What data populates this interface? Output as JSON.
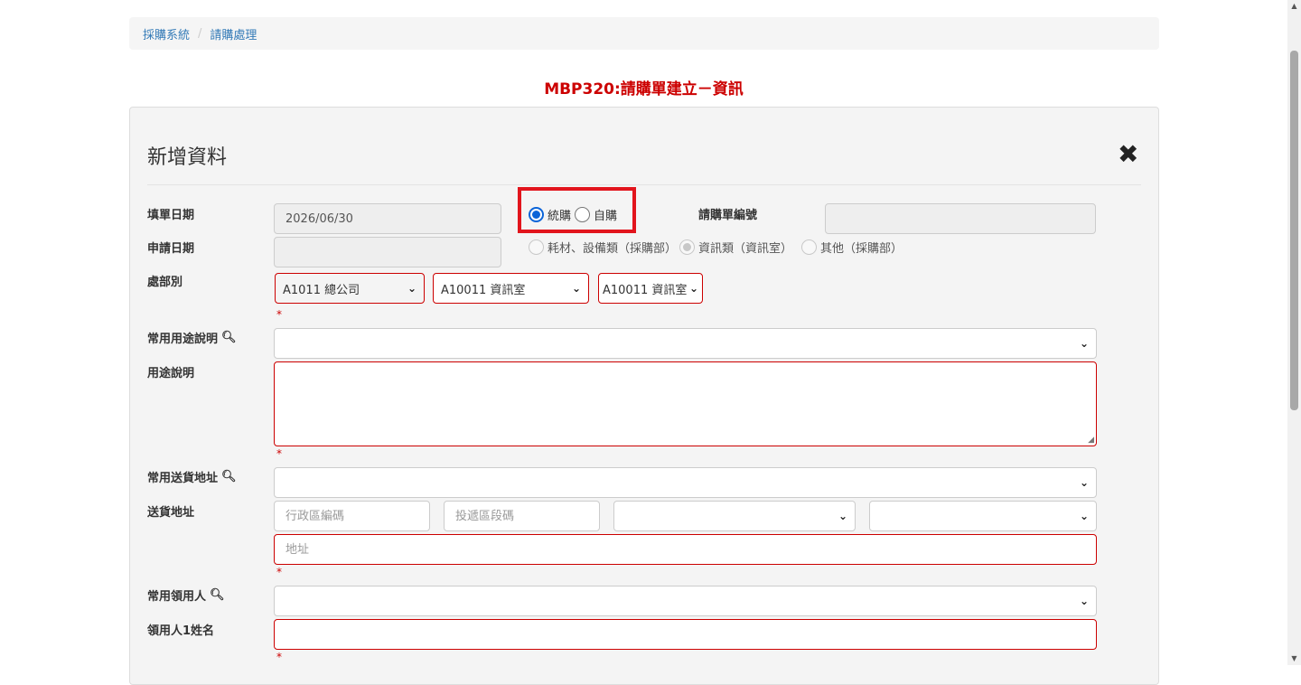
{
  "breadcrumb": {
    "root": "採購系統",
    "separator": "/",
    "current": "請購處理"
  },
  "page_title": "MBP320:請購單建立－資訊",
  "panel": {
    "title": "新增資料",
    "close_icon": "close-icon"
  },
  "form": {
    "fill_date_label": "填單日期",
    "fill_date_value": "2026/06/30",
    "apply_date_label": "申請日期",
    "purchase_type": {
      "option1": "統購",
      "option2": "自購",
      "selected": "統購"
    },
    "category": {
      "option1": "耗材、設備類（採購部）",
      "option2": "資訊類（資訊室）",
      "option3": "其他（採購部）",
      "selected": "資訊類（資訊室）"
    },
    "request_no_label": "請購單編號",
    "dept_label": "處部別",
    "dept_select1": "A1011 總公司",
    "dept_select2": "A10011 資訊室",
    "dept_select3": "A10011 資訊室",
    "required_mark": "*",
    "common_purpose_label": "常用用途說明",
    "purpose_label": "用途說明",
    "common_address_label": "常用送貨地址",
    "address_label": "送貨地址",
    "district_placeholder": "行政區編碼",
    "postal_placeholder": "投遞區段碼",
    "address_placeholder": "地址",
    "common_receiver_label": "常用領用人",
    "receiver1_label": "領用人1姓名"
  },
  "icons": {
    "search": "search-icon",
    "chevron": "chevron-down-icon"
  }
}
